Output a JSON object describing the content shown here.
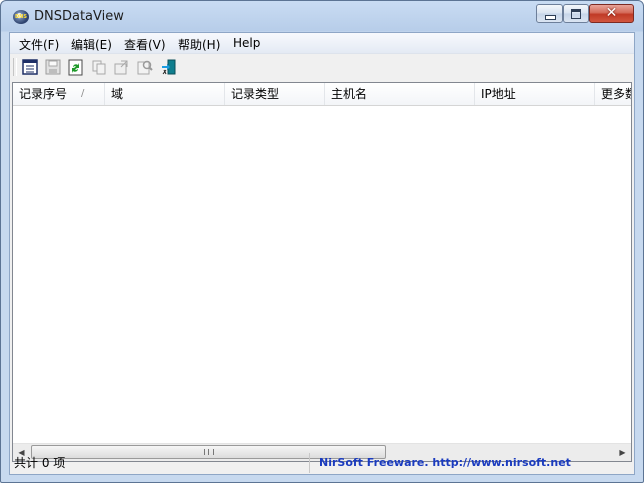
{
  "window": {
    "title": "DNSDataView",
    "icon": "dns-globe-icon",
    "icon_text": "DNS",
    "caption_buttons": {
      "minimize": "minimize-icon",
      "maximize": "maximize-icon",
      "close_glyph": "✕"
    }
  },
  "menu": {
    "items": [
      "文件(F)",
      "编辑(E)",
      "查看(V)",
      "帮助(H)",
      "Help"
    ]
  },
  "toolbar": {
    "buttons": [
      {
        "name": "properties-icon",
        "enabled": true
      },
      {
        "name": "save-icon",
        "enabled": false
      },
      {
        "name": "refresh-icon",
        "enabled": true
      },
      {
        "name": "copy-icon",
        "enabled": false
      },
      {
        "name": "html-report-icon",
        "enabled": false
      },
      {
        "name": "find-icon",
        "enabled": false
      },
      {
        "name": "exit-icon",
        "enabled": true
      }
    ]
  },
  "list": {
    "columns": [
      "记录序号",
      "域",
      "记录类型",
      "主机名",
      "IP地址",
      "更多数"
    ],
    "sort_indicator": "/",
    "rows": []
  },
  "scrollbar": {
    "left": "◀",
    "right": "▶"
  },
  "status": {
    "count": "共计 0 项",
    "credit": "NirSoft Freeware.  http://www.nirsoft.net",
    "credit_color": "#1a3bbf"
  }
}
